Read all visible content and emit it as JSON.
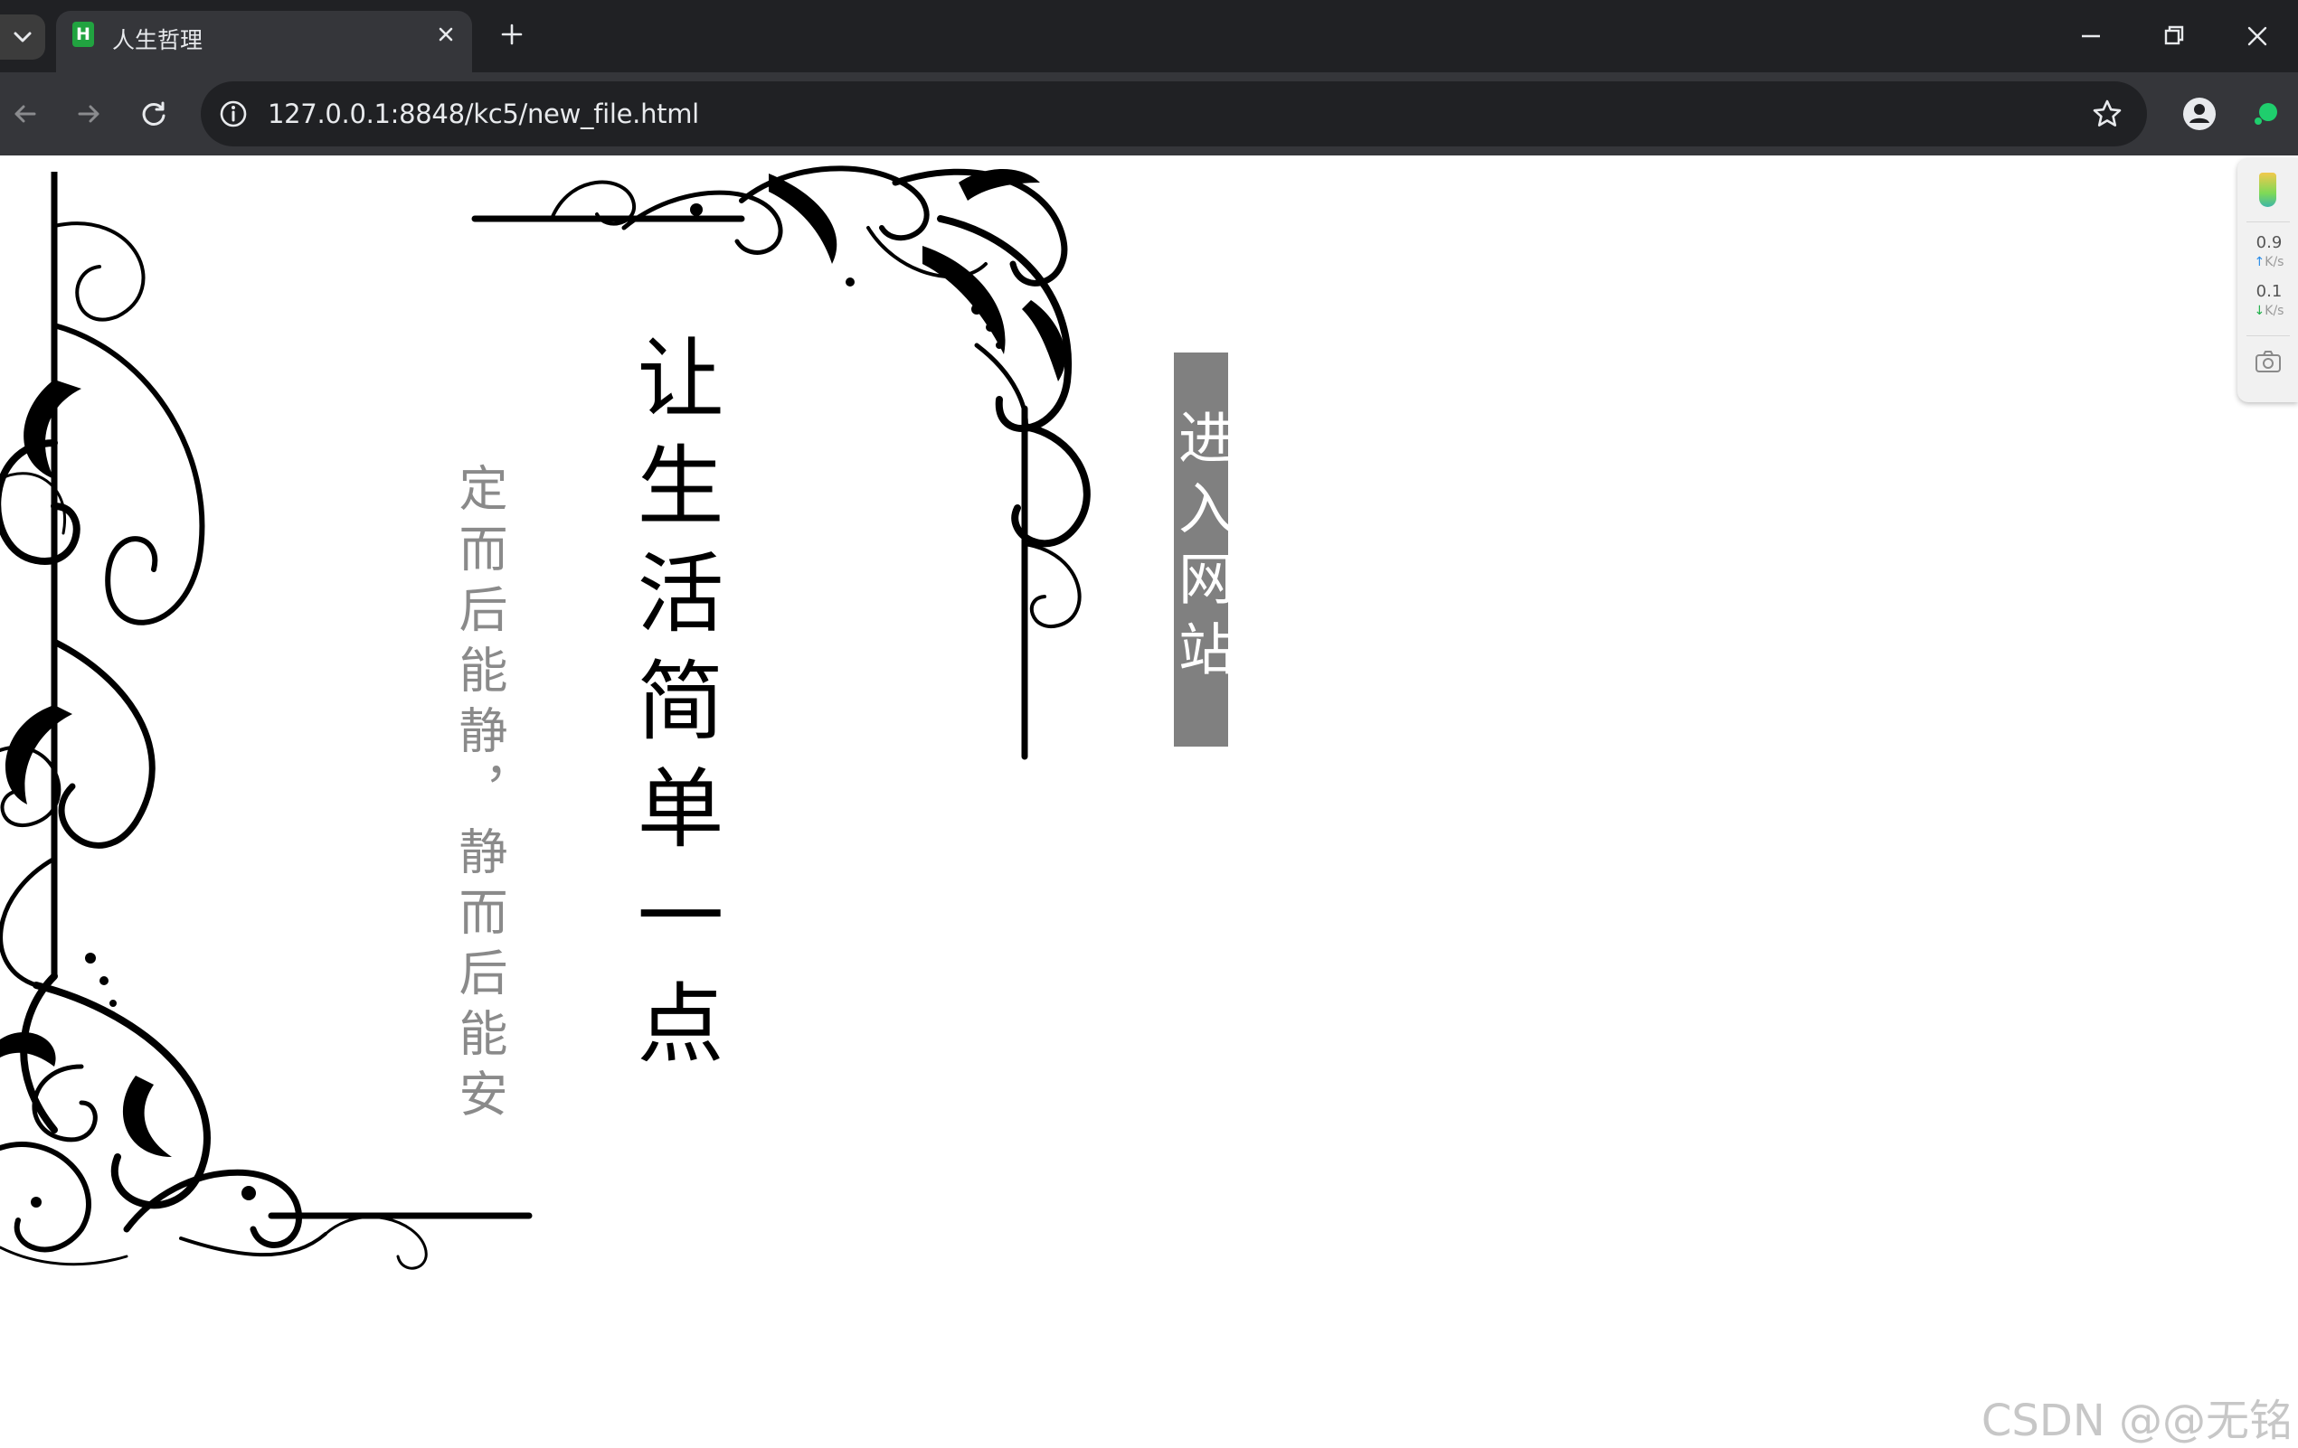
{
  "browser": {
    "tab_title": "人生哲理",
    "favicon_letter": "H",
    "url": "127.0.0.1:8848/kc5/new_file.html"
  },
  "page": {
    "headline": "让生活简单一点",
    "motto": "定而后能静，静而后能安",
    "enter_button": "进入网站",
    "watermark": "CSDN @@无铭"
  },
  "side_widget": {
    "upload_speed": "0.9",
    "download_speed": "0.1",
    "unit": "K/s"
  },
  "colors": {
    "chrome_dark": "#202124",
    "chrome_toolbar": "#35363a",
    "button_gray": "#808080",
    "motto_gray": "#8a8a8a"
  }
}
